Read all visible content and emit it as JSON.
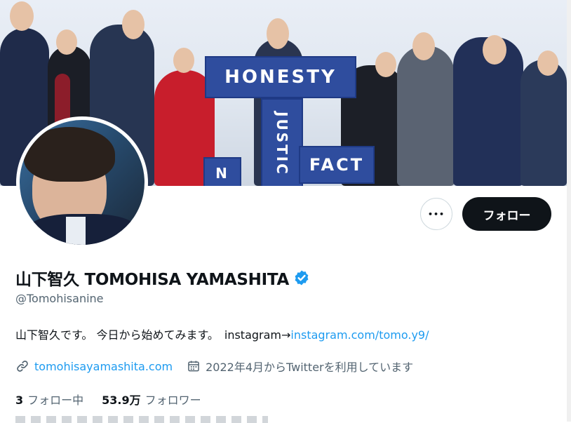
{
  "profile": {
    "display_name": "山下智久 TOMOHISA YAMASHITA",
    "handle": "@Tomohisanine",
    "bio_text": "山下智久です。 今日から始めてみます。　instagram→",
    "bio_link": "instagram.com/tomo.y9/",
    "website": "tomohisayamashita.com",
    "joined": "2022年4月からTwitterを利用しています",
    "following_count": "3",
    "following_label": "フォロー中",
    "followers_count": "53.9万",
    "followers_label": "フォロワー"
  },
  "banner": {
    "sign_1": "HONESTY",
    "sign_2": "JUSTIC",
    "sign_3": "FACT",
    "sign_4": "N"
  },
  "actions": {
    "more_label": "•••",
    "follow_label": "フォロー"
  },
  "icons": {
    "verified": "verified-badge-icon",
    "link": "link-icon",
    "calendar": "calendar-icon",
    "more": "more-icon"
  },
  "colors": {
    "accent": "#1d9bf0",
    "text": "#0f1419",
    "secondary": "#536471",
    "follow_button": "#0f1419"
  }
}
